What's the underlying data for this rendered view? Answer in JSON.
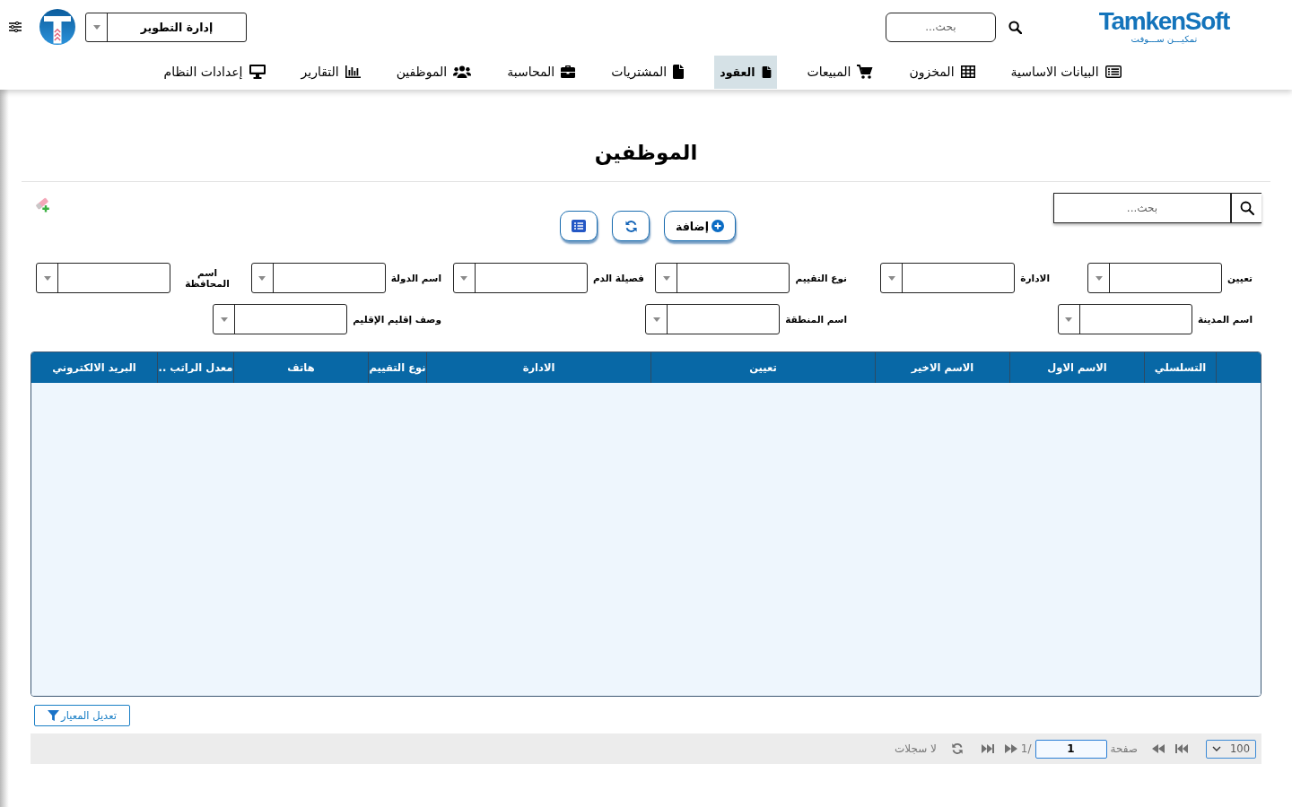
{
  "header": {
    "brand": {
      "name": "TamkenSoft",
      "tagline": "تمكيـــن ســـوفت"
    },
    "search": {
      "placeholder": "بحث..."
    },
    "department_select": {
      "value": "إدارة التطوير"
    }
  },
  "nav": [
    {
      "label": "البيانات الاساسية",
      "selected": false
    },
    {
      "label": "المخزون",
      "selected": false
    },
    {
      "label": "المبيعات",
      "selected": false
    },
    {
      "label": "العقود",
      "selected": true
    },
    {
      "label": "المشتريات",
      "selected": false
    },
    {
      "label": "المحاسبة",
      "selected": false
    },
    {
      "label": "الموظفين",
      "selected": false
    },
    {
      "label": "التقارير",
      "selected": false
    },
    {
      "label": "إعدادات النظام",
      "selected": false
    }
  ],
  "page": {
    "title": "الموظفين",
    "search": {
      "placeholder": "بحث..."
    },
    "add_button": {
      "label": "إضافة"
    }
  },
  "filter_rows": [
    {
      "fields": [
        {
          "label": "تعيين"
        },
        {
          "label": "الادارة"
        },
        {
          "label": "نوع التقييم"
        },
        {
          "label": "فصيلة الدم"
        },
        {
          "label": "اسم الدولة"
        },
        {
          "label": "اسم المحافظة"
        }
      ]
    },
    {
      "fields": [
        {
          "label": "اسم المدينة"
        },
        {
          "label": "اسم المنطقة"
        },
        {
          "label": "وصف إقليم الإقليم"
        }
      ]
    }
  ],
  "table": {
    "columns": [
      "التسلسلي",
      "الاسم الاول",
      "الاسم الاخير",
      "تعيين",
      "الادارة",
      "نوع التقييم",
      "هاتف",
      "معدل الراتب ..",
      "البريد الالكتروني"
    ]
  },
  "filter_button": {
    "label": "تعديل المعيار"
  },
  "pager": {
    "page_size": "100",
    "page_label": "صفحة",
    "page": "1",
    "page_count": "/1",
    "status": "لا سجلات"
  }
}
